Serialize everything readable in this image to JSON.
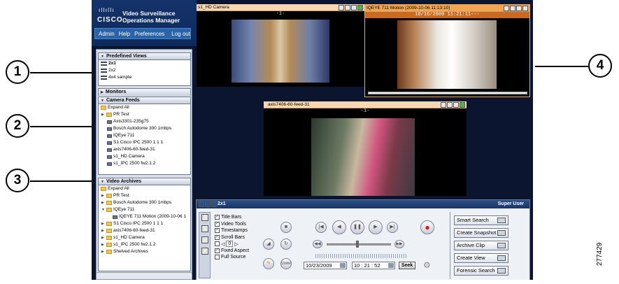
{
  "brand": {
    "company": "CISCO",
    "product_line1": "Video Surveillance",
    "product_line2": "Operations Manager"
  },
  "menu": [
    "Admin",
    "Help",
    "Preferences",
    "Log out"
  ],
  "predefined_views": {
    "title": "Predefined Views",
    "items": [
      "2x1",
      "2x2",
      "4x4 sample"
    ]
  },
  "monitors": {
    "title": "Monitors"
  },
  "camera_feeds": {
    "title": "Camera Feeds",
    "items": [
      "Expand All",
      "PR Test",
      "Axis3301-235g75",
      "Bosch Autodome 300 1mbps",
      "IQEye 711",
      "S1 Cisco IPC 2500 1 1 1",
      "axis7406-60-feed-31",
      "s1_HD Camera",
      "s1_IPC 2500 fw2.1.2"
    ]
  },
  "video_archives": {
    "title": "Video Archives",
    "items": [
      "Expand All",
      "PR Test",
      "Bosch Autodome 300 1mbps",
      "IQEye 711",
      "IQEYE 711 Motion (2009-10-06 1",
      "S1 Cisco IPC 2500 1 1 1",
      "axis7406-60-feed-31",
      "s1_HD Camera",
      "s1_IPC 2500 fw2.1.2",
      "Shelved Archives"
    ]
  },
  "feeds": {
    "feed1": {
      "title": "s1_HD Camera",
      "stamp": "-1-"
    },
    "feed2": {
      "title": "IQEYE 711 Motion (2009-10-06 11:13:10)",
      "stamp": "10/16/2009  11:21:11---"
    },
    "feed3": {
      "title": "axis7406-60-feed-31",
      "stamp": "-1-"
    }
  },
  "control": {
    "view_name": "2x1",
    "user": "Super User",
    "options": [
      "Title Bars",
      "Video Tools",
      "Timestamps",
      "Scroll Bars",
      "Fixed Aspect",
      "Full Source"
    ],
    "spinner_value": "0",
    "date": "10/23/2009",
    "time": "10 : 21 : 52",
    "seek": "Seek",
    "swap": "SWAP",
    "actions": [
      "Smart Search",
      "Create Snapshot",
      "Archive Clip",
      "Create View",
      "Forensic Search"
    ]
  },
  "callouts": [
    "1",
    "2",
    "3",
    "4"
  ],
  "figure_id": "277429",
  "colors": {
    "accent": "#f3a64f",
    "header": "#14336b"
  }
}
